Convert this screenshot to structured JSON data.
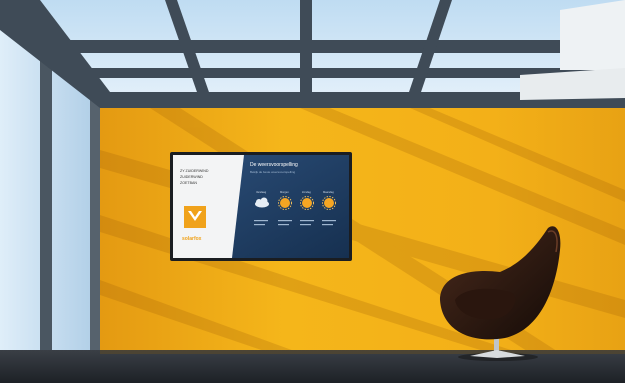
{
  "colors": {
    "wall_yellow": "#f4b317",
    "wall_shadow": "#d98f10",
    "sky": "#cfe6f7",
    "frame_dark": "#3d4a55",
    "floor_dark": "#2a2f36",
    "screen_blue": "#1f3b5f",
    "logo_orange": "#f0a21b"
  },
  "screen": {
    "left_panel": {
      "lines": [
        "ZY ZUIDERWIND",
        "ZUIDERWIND",
        "ZOETBAN"
      ],
      "logo_text": "solarfox"
    },
    "right_panel": {
      "title": "De weersvoorspelling",
      "subtitle": "Bekijk de beste weersvoorspelling",
      "days": [
        "Vandaag",
        "Morgen",
        "Zondag",
        "Maandag"
      ],
      "conditions": [
        "cloud-icon",
        "sun-icon",
        "sun-icon",
        "sun-icon"
      ]
    }
  }
}
